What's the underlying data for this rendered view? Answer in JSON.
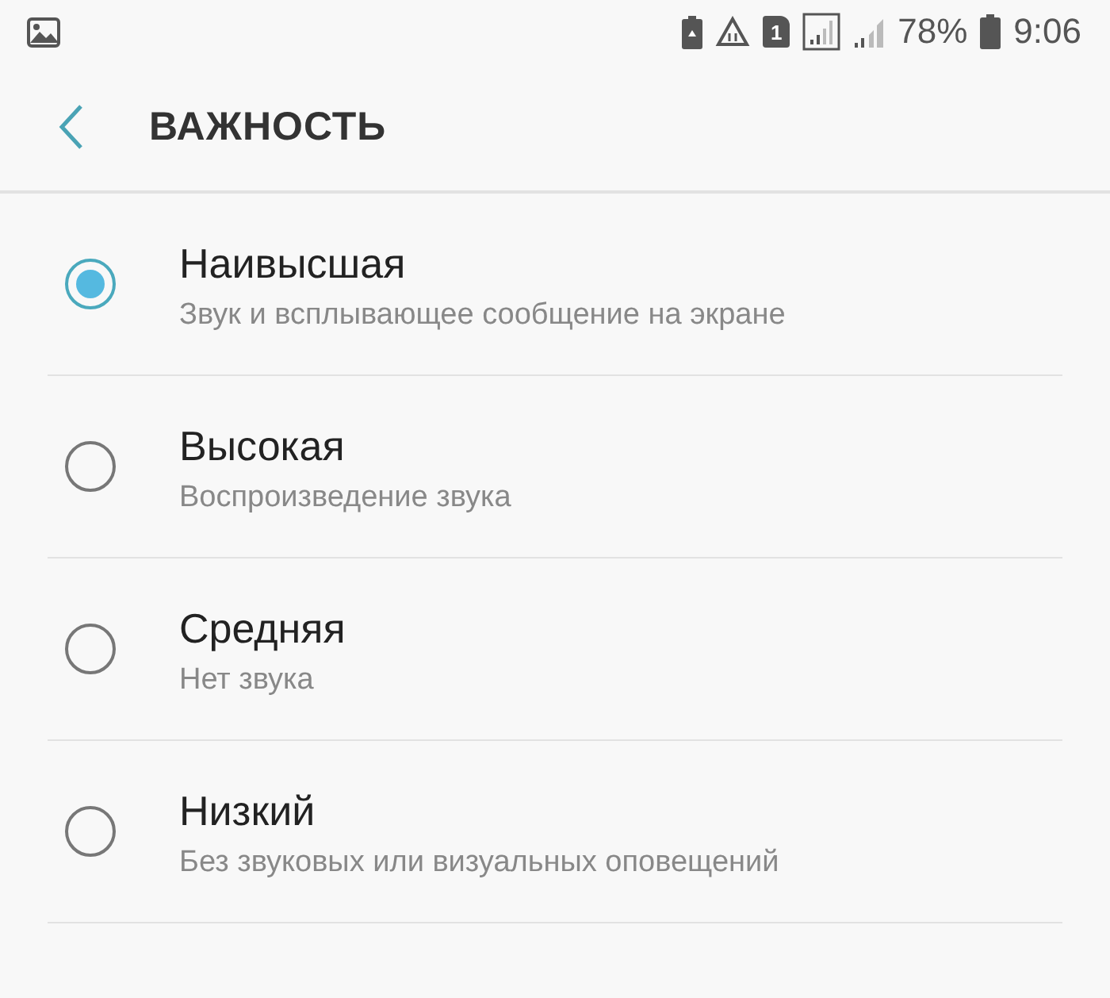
{
  "status_bar": {
    "battery_percent": "78%",
    "time": "9:06",
    "sim_label": "1"
  },
  "header": {
    "title": "ВАЖНОСТЬ"
  },
  "options": [
    {
      "title": "Наивысшая",
      "description": "Звук и всплывающее сообщение на экране",
      "selected": true
    },
    {
      "title": "Высокая",
      "description": "Воспроизведение звука",
      "selected": false
    },
    {
      "title": "Средняя",
      "description": "Нет звука",
      "selected": false
    },
    {
      "title": "Низкий",
      "description": "Без звуковых или визуальных оповещений",
      "selected": false
    }
  ]
}
